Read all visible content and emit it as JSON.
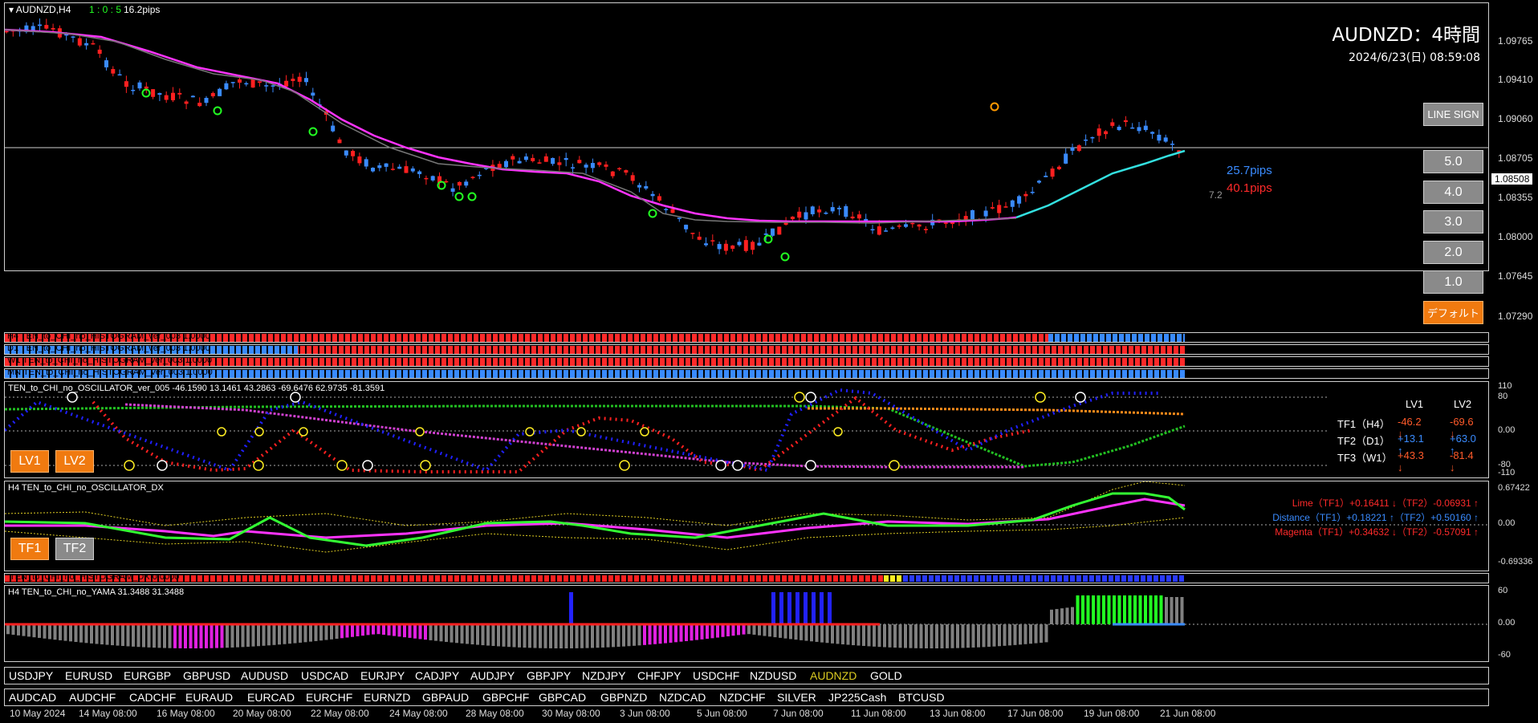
{
  "header": {
    "symbol_label": "AUDNZD,H4",
    "timer": "1 : 0 : 5",
    "timer_pips": "16.2pips",
    "title": "AUDNZD：4時間",
    "datetime": "2024/6/23(日) 08:59:08"
  },
  "price": {
    "current": "1.08508",
    "pips_up": "25.7pips",
    "pips_down": "40.1pips",
    "spread": "7.2",
    "axis": [
      "1.09765",
      "1.09410",
      "1.09060",
      "1.08705",
      "1.08355",
      "1.08000",
      "1.07645",
      "1.07290"
    ]
  },
  "buttons": {
    "line_sign": "LINE SIGN",
    "lvls": [
      "5.0",
      "4.0",
      "3.0",
      "2.0",
      "1.0"
    ],
    "default": "デフォルト",
    "lv1": "LV1",
    "lv2": "LV2",
    "tf1": "TF1",
    "tf2": "TF2"
  },
  "histograms": [
    "H4 TEN_to_CHI_no_HISTOGRAM_ver_003 1.0000",
    "D1 TEN_to_CHI_no_HISTOGRAM_ver_003 1.0000",
    "W1 TEN_to_CHI_no_HISTOGRAM_ver_003 1.0000",
    "MN TEN_to_CHI_no_HISTOGRAM_ver_003 1.0000"
  ],
  "oscillator": {
    "label": "TEN_to_CHI_no_OSCILLATOR_ver_005 -46.1590 13.1461 43.2863 -69.6476 62.9735 -81.3591",
    "axis": [
      "110",
      "80",
      "0.00",
      "-80",
      "-110"
    ],
    "head_lv1": "LV1",
    "head_lv2": "LV2",
    "rows": [
      {
        "name": "TF1（H4）",
        "lv1": "-46.2 ↓",
        "lv2": "-69.6 ↓"
      },
      {
        "name": "TF2（D1）",
        "lv1": "+13.1 ↑",
        "lv2": "+63.0 ↑"
      },
      {
        "name": "TF3（W1）",
        "lv1": "+43.3 ↓",
        "lv2": "-81.4 ↓"
      }
    ]
  },
  "oscillator_dx": {
    "label": "H4 TEN_to_CHI_no_OSCILLATOR_DX",
    "axis": [
      "0.67422",
      "0.00",
      "-0.69336"
    ],
    "rows": [
      {
        "text": "Lime（TF1）+0.16411 ↓（TF2）-0.06931 ↑",
        "color": "#ff2a2a"
      },
      {
        "text": "Distance（TF1）+0.18221 ↑（TF2）+0.50160 ↑",
        "color": "#3a8bff"
      },
      {
        "text": "Magenta（TF1）+0.34632 ↓（TF2）-0.57091 ↑",
        "color": "#ff2a2a"
      }
    ]
  },
  "histogram_dx": {
    "label": "TEN_to_CHI_no_HISTOGRAM_DX 0.0000"
  },
  "yama": {
    "label": "H4 TEN_to_CHI_no_YAMA 31.3488 31.3488",
    "axis": [
      "60",
      "0.00",
      "-60"
    ]
  },
  "symbols_row1": [
    "USDJPY",
    "EURUSD",
    "EURGBP",
    "GBPUSD",
    "AUDUSD",
    "USDCAD",
    "EURJPY",
    "CADJPY",
    "AUDJPY",
    "GBPJPY",
    "NZDJPY",
    "CHFJPY",
    "USDCHF",
    "NZDUSD",
    "AUDNZD",
    "GOLD"
  ],
  "symbols_row2": [
    "AUDCAD",
    "AUDCHF",
    "CADCHF",
    "EURAUD",
    "EURCAD",
    "EURCHF",
    "EURNZD",
    "GBPAUD",
    "GBPCHF",
    "GBPCAD",
    "GBPNZD",
    "NZDCAD",
    "NZDCHF",
    "SILVER",
    "JP225Cash",
    "BTCUSD"
  ],
  "active_symbol": "AUDNZD",
  "dates": [
    "10 May 2024",
    "14 May 08:00",
    "16 May 08:00",
    "20 May 08:00",
    "22 May 08:00",
    "24 May 08:00",
    "28 May 08:00",
    "30 May 08:00",
    "3 Jun 08:00",
    "5 Jun 08:00",
    "7 Jun 08:00",
    "11 Jun 08:00",
    "13 Jun 08:00",
    "17 Jun 08:00",
    "19 Jun 08:00",
    "21 Jun 08:00"
  ],
  "colors": {
    "up": "#3a8bff",
    "down": "#ff2020",
    "ma": "#ff33ff",
    "ma2": "#33e0e0",
    "accent": "#f07a10"
  }
}
